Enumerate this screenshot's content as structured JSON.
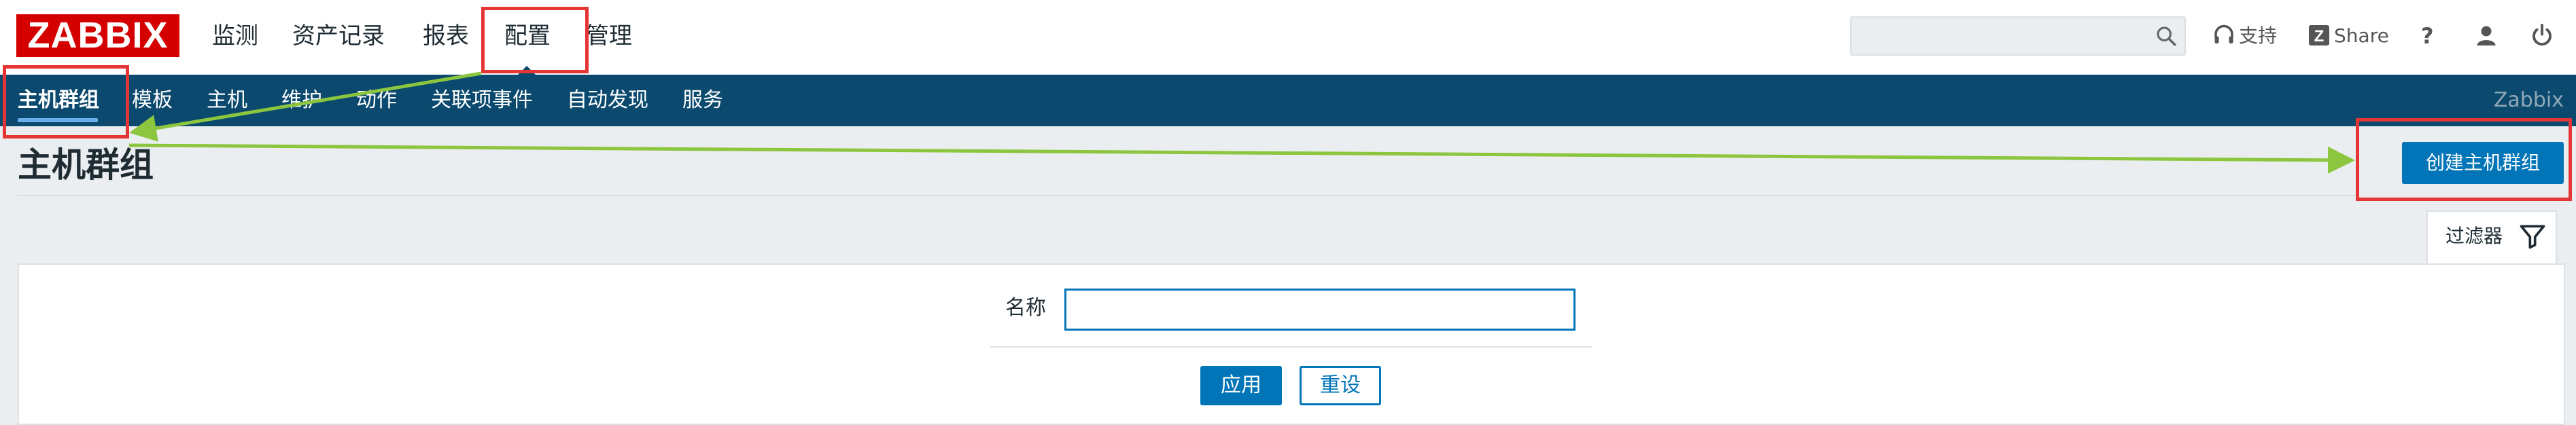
{
  "app": {
    "logo_text": "ZABBIX",
    "brand_color": "#d40000"
  },
  "main_menu": [
    {
      "label": "监测"
    },
    {
      "label": "资产记录"
    },
    {
      "label": "报表"
    },
    {
      "label": "配置",
      "active": true
    },
    {
      "label": "管理"
    }
  ],
  "top_utils": {
    "search_placeholder": "",
    "support_label": "支持",
    "share_label": "Share",
    "help_label": "?",
    "icons": [
      "search-icon",
      "headset-icon",
      "zabbix-share-icon",
      "help-icon",
      "user-icon",
      "power-icon"
    ]
  },
  "sub_menu": [
    {
      "label": "主机群组",
      "active": true
    },
    {
      "label": "模板"
    },
    {
      "label": "主机"
    },
    {
      "label": "维护"
    },
    {
      "label": "动作"
    },
    {
      "label": "关联项事件"
    },
    {
      "label": "自动发现"
    },
    {
      "label": "服务"
    }
  ],
  "navbar_brand": "Zabbix",
  "page": {
    "title": "主机群组",
    "create_button": "创建主机群组"
  },
  "filter": {
    "tab_label": "过滤器",
    "name_label": "名称",
    "name_value": "",
    "apply_label": "应用",
    "reset_label": "重设"
  },
  "colors": {
    "nav_bg": "#0b4a6e",
    "primary_button": "#0275b8",
    "annotation_box": "#e53535",
    "annotation_arrow": "#8cc63f"
  }
}
